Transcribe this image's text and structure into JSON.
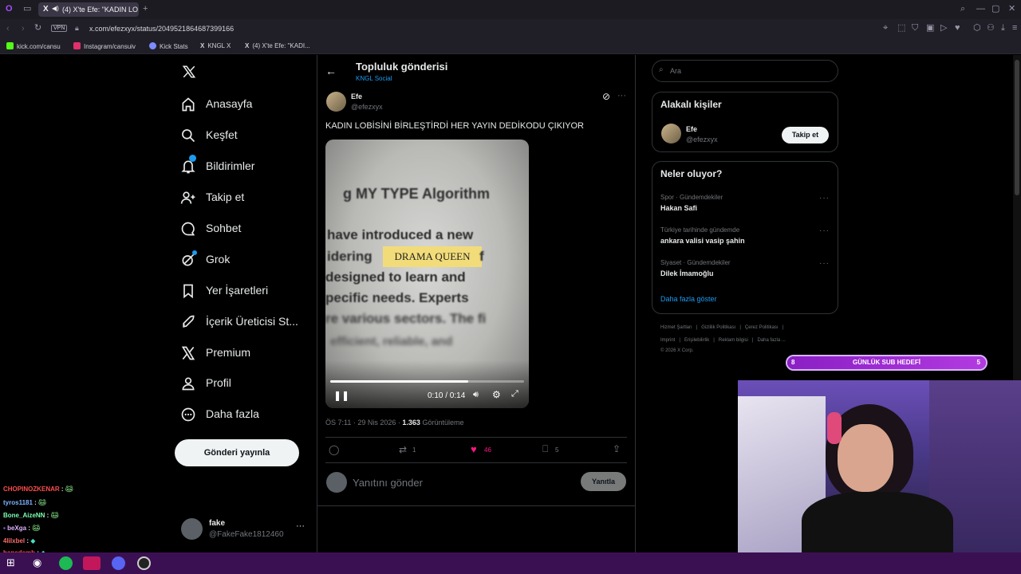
{
  "browser": {
    "tab_title": "(4) X'te Efe: \"KADIN LO",
    "url": "x.com/efezxyx/status/2049521864687399166",
    "vpn": "VPN",
    "bookmarks": [
      "kick.com/cansu",
      "Instagram/cansuiv",
      "Kick Stats",
      "KNGL X",
      "(4) X'te Efe: \"KADI..."
    ]
  },
  "nav": {
    "items": [
      "Anasayfa",
      "Keşfet",
      "Bildirimler",
      "Takip et",
      "Sohbet",
      "Grok",
      "Yer İşaretleri",
      "İçerik Üreticisi St...",
      "Premium",
      "Profil",
      "Daha fazla"
    ],
    "post_button": "Gönderi yayınla",
    "account_name": "fake",
    "account_handle": "@FakeFake1812460"
  },
  "header": {
    "title": "Topluluk gönderisi",
    "community": "KNGL Social"
  },
  "tweet": {
    "author": "Efe",
    "handle": "@efezxyx",
    "text": "KADIN LOBİSİNİ BİRLEŞTİRDİ HER YAYIN DEDİKODU ÇIKIYOR",
    "video_lines": [
      "g MY TYPE Algorithm",
      "have introduced a new",
      "idering",
      "DRAMA QUEEN",
      "f",
      "designed to learn and",
      "pecific needs. Experts",
      "re various sectors. The fi",
      "efficient, reliable, and"
    ],
    "video_time": "0:10 / 0:14",
    "video_progress": 0.71,
    "timestamp": "ÖS 7:11 · 29 Nis 2026 ·",
    "views_count": "1.363",
    "views_label": "Görüntüleme",
    "retweets": "1",
    "likes": "46",
    "bookmarks": "5",
    "reply_placeholder": "Yanıtını gönder",
    "reply_button": "Yanıtla"
  },
  "sidebar": {
    "search_placeholder": "Ara",
    "relevant_title": "Alakalı kişiler",
    "relevant_name": "Efe",
    "relevant_handle": "@efezxyx",
    "follow_button": "Takip et",
    "trends_title": "Neler oluyor?",
    "trends": [
      {
        "category": "Spor · Gündemdekiler",
        "name": "Hakan Safi"
      },
      {
        "category": "Türkiye tarihinde gündemde",
        "name": "ankara valisi vasip şahin"
      },
      {
        "category": "Siyaset · Gündemdekiler",
        "name": "Dilek İmamoğlu"
      }
    ],
    "show_more": "Daha fazla göster",
    "footer_row1": [
      "Hizmet Şartları",
      "|",
      "Gizlilik Politikası",
      "|",
      "Çerez Politikası",
      "|"
    ],
    "footer_row2": [
      "Imprint",
      "|",
      "Erişilebilirlik",
      "|",
      "Reklam bilgisi",
      "|",
      "Daha fazla ..."
    ],
    "copyright": "© 2026 X Corp."
  },
  "overlay": {
    "sub_goal_left": "8",
    "sub_goal_label": "GÜNLÜK SUB HEDEFİ",
    "sub_goal_right": "5",
    "sub_goal_progress": 0.0
  },
  "chat": [
    {
      "user": "CHOPINOZKENAR",
      "color": "#ff4d4d"
    },
    {
      "user": "tyros1181",
      "color": "#7fb4ff"
    },
    {
      "user": "Bone_AizeNN",
      "color": "#7dffb0"
    },
    {
      "user": "beXga",
      "color": "#e0b0ff"
    },
    {
      "user": "4lilxbel",
      "color": "#ff6b6b"
    },
    {
      "user": "hapedemb",
      "color": "#ff4d4d"
    }
  ],
  "colors": {
    "accent": "#1d9bf0",
    "like": "#f91880",
    "overlay": "#9b2fd1"
  }
}
